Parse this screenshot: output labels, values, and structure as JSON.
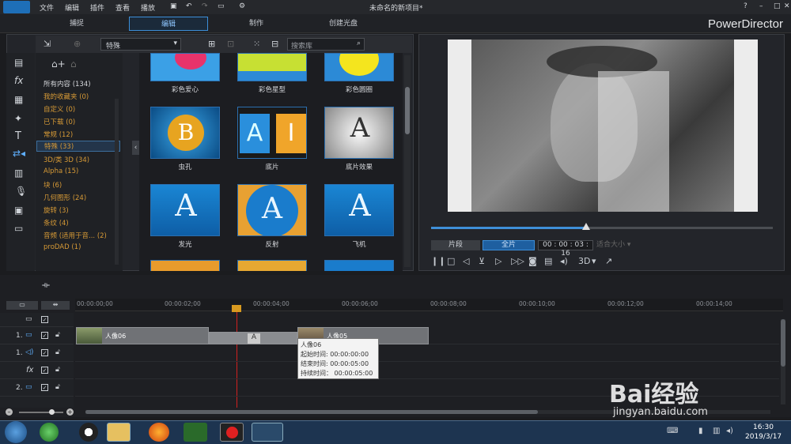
{
  "app": {
    "title": "未命名的新项目*",
    "brand": "PowerDirector"
  },
  "menu": [
    "文件",
    "编辑",
    "插件",
    "查看",
    "播放"
  ],
  "modes": [
    {
      "label": "捕捉"
    },
    {
      "label": "编辑"
    },
    {
      "label": "制作"
    },
    {
      "label": "创建光盘"
    }
  ],
  "window_controls": {
    "help": "?",
    "minimize": "–",
    "maximize": "□",
    "close": "✕"
  },
  "library": {
    "dropdown": "特殊",
    "search_placeholder": "搜索库",
    "categories": [
      {
        "label": "所有内容 (134)",
        "color": "white"
      },
      {
        "label": "我的收藏夹 (0)"
      },
      {
        "label": "自定义 (0)"
      },
      {
        "label": "已下载 (0)"
      },
      {
        "label": "常规 (12)"
      },
      {
        "label": "特殊 (33)",
        "selected": true
      },
      {
        "label": "3D/类 3D (34)"
      },
      {
        "label": "Alpha (15)"
      },
      {
        "label": "块 (6)"
      },
      {
        "label": "几何图形 (24)"
      },
      {
        "label": "旋转 (3)"
      },
      {
        "label": "条纹 (4)"
      },
      {
        "label": "音频 (适用于音... (2)"
      },
      {
        "label": "proDAD (1)"
      }
    ],
    "items": [
      {
        "label": "彩色爱心"
      },
      {
        "label": "彩色星型"
      },
      {
        "label": "彩色圆圈"
      },
      {
        "label": "虫孔"
      },
      {
        "label": "底片"
      },
      {
        "label": "底片效果"
      },
      {
        "label": "发光"
      },
      {
        "label": "反射"
      },
      {
        "label": "飞机"
      }
    ]
  },
  "preview": {
    "clip_btn": "片段",
    "movie_btn": "全片",
    "timecode": "00 : 00 : 03 : 16",
    "fit": "适合大小",
    "mode_3d": "3D"
  },
  "timeline": {
    "ticks": [
      "00:00:00;00",
      "00:00:02;00",
      "00:00:04;00",
      "00:00:06;00",
      "00:00:08;00",
      "00:00:10;00",
      "00:00:12;00",
      "00:00:14;00"
    ],
    "tracks": [
      {
        "label": "1."
      },
      {
        "label": "1."
      },
      {
        "label": "fx"
      },
      {
        "label": "2."
      }
    ],
    "clips": [
      {
        "label": "人像06"
      },
      {
        "label": "人像05"
      }
    ],
    "transition": "A",
    "tooltip": {
      "title": "人像06",
      "start": "起始时间: 00:00:00:00",
      "end": "结束时间: 00:00:05:00",
      "duration": "持续时间： 00:00:05:00"
    }
  },
  "taskbar": {
    "time": "16:30",
    "date": "2019/3/17"
  },
  "watermark": {
    "text": "Bai经验",
    "url": "jingyan.baidu.com"
  }
}
